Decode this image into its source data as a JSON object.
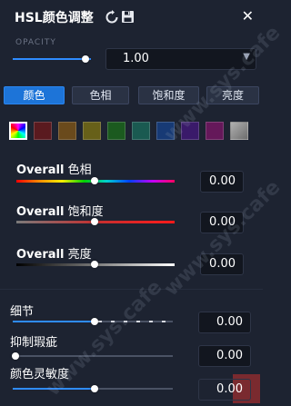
{
  "header": {
    "title": "HSL颜色调整",
    "reset_icon": "reset-icon",
    "save_icon": "save-icon",
    "close_icon": "close-icon"
  },
  "opacity": {
    "label": "OPACITY",
    "value": "1.00",
    "slider_fraction": 1.0
  },
  "tabs": [
    {
      "label": "颜色",
      "active": true
    },
    {
      "label": "色相",
      "active": false
    },
    {
      "label": "饱和度",
      "active": false
    },
    {
      "label": "亮度",
      "active": false
    }
  ],
  "swatches": [
    {
      "name": "all",
      "color": "gradient"
    },
    {
      "name": "red",
      "color": "#5a1a1f"
    },
    {
      "name": "orange",
      "color": "#6a4a1c"
    },
    {
      "name": "yellow",
      "color": "#676019"
    },
    {
      "name": "green",
      "color": "#1b5a1f"
    },
    {
      "name": "aqua",
      "color": "#1a5a51"
    },
    {
      "name": "blue",
      "color": "#173a75"
    },
    {
      "name": "purple",
      "color": "#3a1a6a"
    },
    {
      "name": "magenta",
      "color": "#65185a"
    },
    {
      "name": "gray",
      "color": "#8a8a8a"
    }
  ],
  "adjustments": {
    "hue": {
      "label_bold": "Overall",
      "label": "色相",
      "value": "0.00"
    },
    "saturation": {
      "label_bold": "Overall",
      "label": "饱和度",
      "value": "0.00"
    },
    "lightness": {
      "label_bold": "Overall",
      "label": "亮度",
      "value": "0.00"
    }
  },
  "detail": {
    "detail": {
      "label": "细节",
      "value": "0.00"
    },
    "suppress": {
      "label": "抑制瑕疵",
      "value": "0.00"
    },
    "sensitivity": {
      "label": "颜色灵敏度",
      "value": "0.00"
    }
  },
  "watermark": "www.sys.cafe",
  "colors": {
    "background": "#1d2331",
    "accent": "#2f8cff",
    "tab_active": "#1d74d8"
  }
}
